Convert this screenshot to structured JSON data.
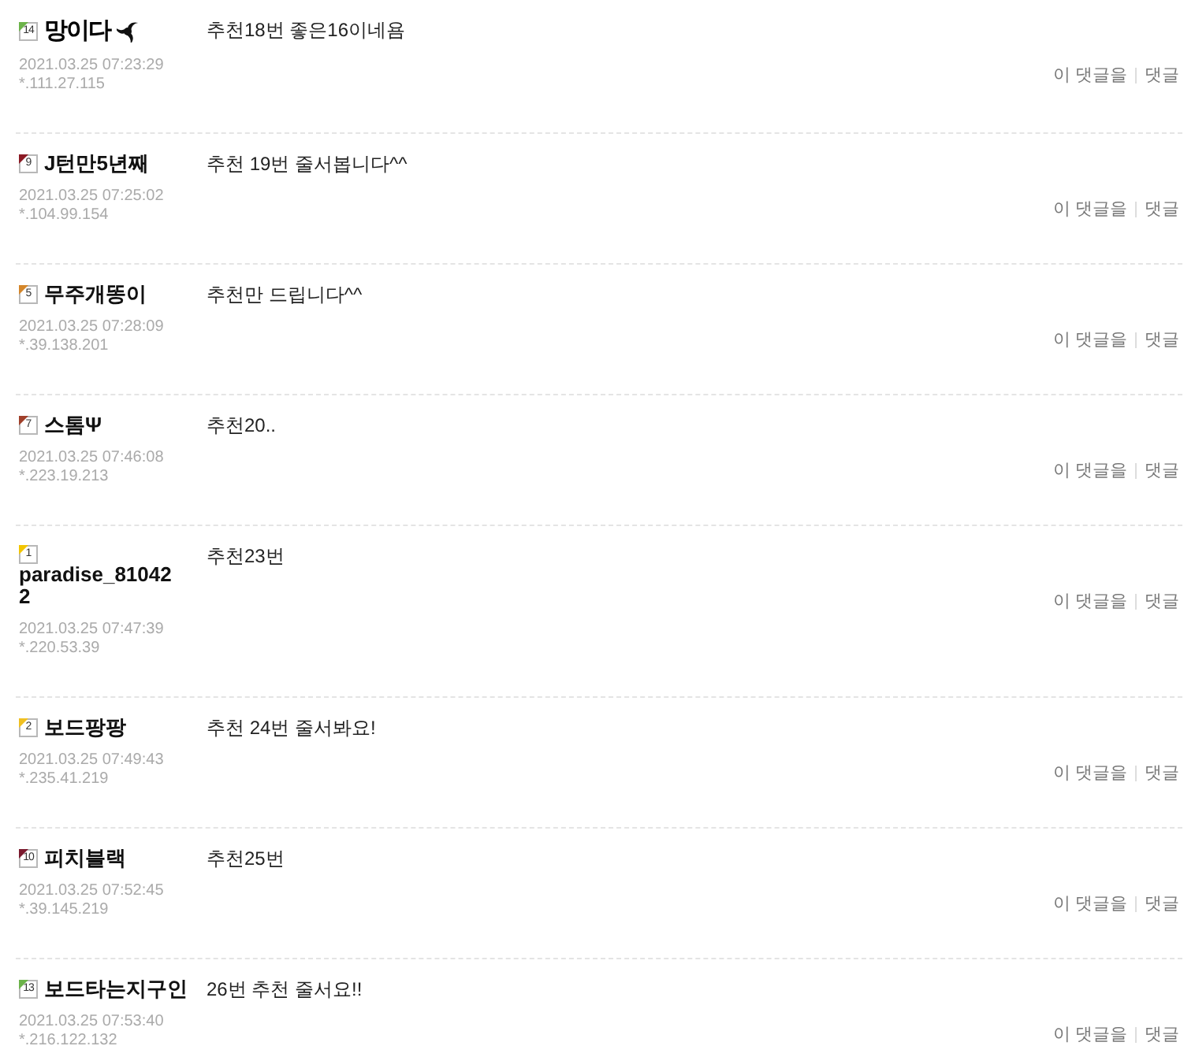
{
  "comments": [
    {
      "kind": "image",
      "level_badge": {
        "label": "14",
        "color": "#6cb34a"
      },
      "nickname": "망이다",
      "date": "2021.03.25 07:23:29",
      "ip": "*.111.27.115",
      "text": "추천18번 좋은16이네욤",
      "actions": [
        "이 댓글을",
        "댓글"
      ]
    },
    {
      "kind": "text",
      "level_badge": {
        "label": "9",
        "color": "#8b1a24"
      },
      "nickname": "J턴만5년째",
      "date": "2021.03.25 07:25:02",
      "ip": "*.104.99.154",
      "text": "추천 19번 줄서봅니다^^",
      "actions": [
        "이 댓글을",
        "댓글"
      ]
    },
    {
      "kind": "text",
      "level_badge": {
        "label": "5",
        "color": "#d4862a"
      },
      "nickname": "무주개똥이",
      "date": "2021.03.25 07:28:09",
      "ip": "*.39.138.201",
      "text": "추천만 드립니다^^",
      "actions": [
        "이 댓글을",
        "댓글"
      ]
    },
    {
      "kind": "text",
      "level_badge": {
        "label": "7",
        "color": "#a0402a"
      },
      "nickname": "스톰Ψ",
      "date": "2021.03.25 07:46:08",
      "ip": "*.223.19.213",
      "text": "추천20..",
      "actions": [
        "이 댓글을",
        "댓글"
      ]
    },
    {
      "kind": "text",
      "level_badge": {
        "label": "1",
        "color": "#f2c500"
      },
      "nickname": "paradise_810422",
      "date": "2021.03.25 07:47:39",
      "ip": "*.220.53.39",
      "text": "추천23번",
      "actions": [
        "이 댓글을",
        "댓글"
      ]
    },
    {
      "kind": "text",
      "level_badge": {
        "label": "2",
        "color": "#f0c020"
      },
      "nickname": "보드팡팡",
      "date": "2021.03.25 07:49:43",
      "ip": "*.235.41.219",
      "text": "추천 24번 줄서봐요!",
      "actions": [
        "이 댓글을",
        "댓글"
      ]
    },
    {
      "kind": "text",
      "level_badge": {
        "label": "10",
        "color": "#7a1a2e"
      },
      "nickname": "피치블랙",
      "date": "2021.03.25 07:52:45",
      "ip": "*.39.145.219",
      "text": "추천25번",
      "actions": [
        "이 댓글을",
        "댓글"
      ]
    },
    {
      "kind": "text",
      "level_badge": {
        "label": "13",
        "color": "#6cb34a"
      },
      "nickname": "보드타는지구인",
      "date": "2021.03.25 07:53:40",
      "ip": "*.216.122.132",
      "text": "26번 추천 줄서요!!",
      "actions": [
        "이 댓글을",
        "댓글"
      ]
    }
  ]
}
